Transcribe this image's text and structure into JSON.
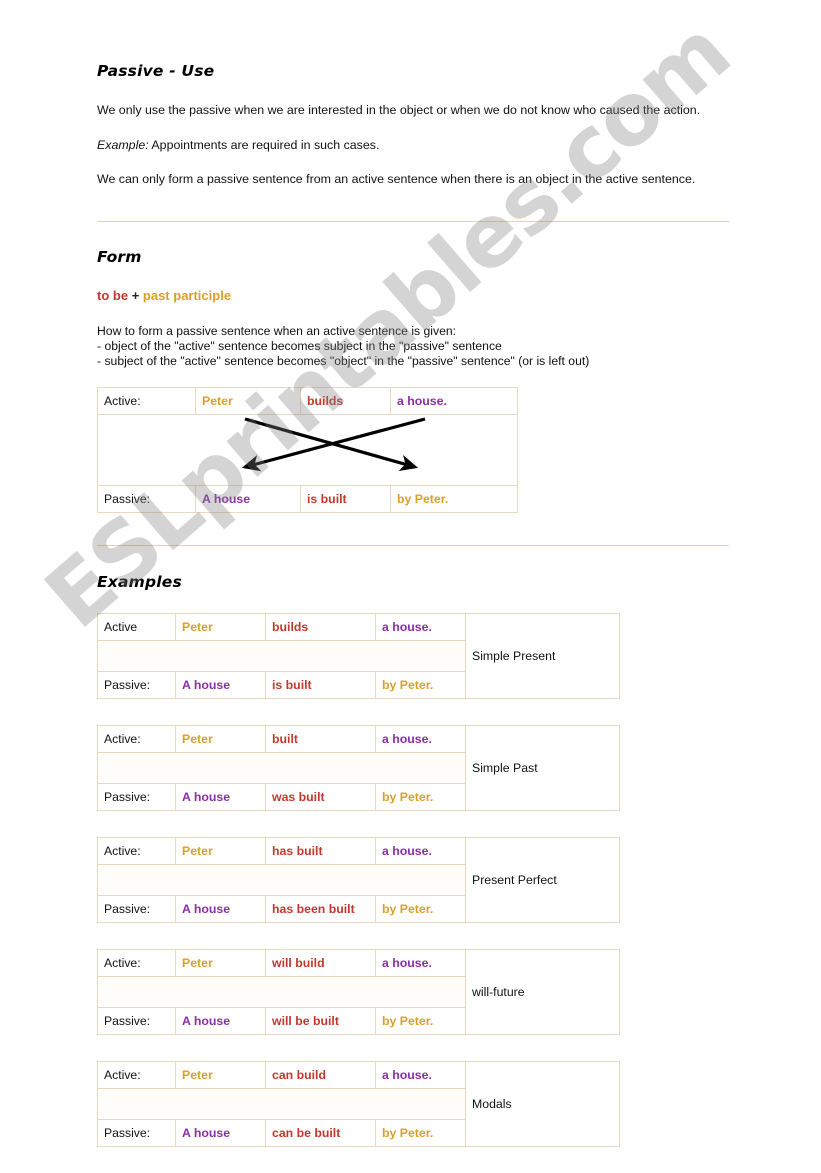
{
  "document": {
    "watermark": "ESLprintables.com"
  },
  "sections": {
    "use": {
      "title": "Passive - Use",
      "paragraph1": "We only use the passive when we are interested in the object or when we do not know who caused the action.",
      "example_label": "Example:",
      "example_text": "Appointments are required in such cases.",
      "paragraph2": "We can only form a passive sentence from an active sentence when there is an object in the active sentence."
    },
    "form": {
      "title": "Form",
      "formula": {
        "to_be": "to be",
        "plus": "+",
        "past_participle": "past participle"
      },
      "rules_intro": "How to form a passive sentence when an active sentence is given:",
      "rule1": "- object of the \"active\" sentence becomes subject in the \"passive\" sentence",
      "rule2": "- subject of the \"active\" sentence becomes \"object\" in the \"passive\" sentence\" (or is left out)",
      "table": {
        "active_label": "Active:",
        "active_subject": "Peter",
        "active_verb": "builds",
        "active_object": "a house.",
        "passive_label": "Passive:",
        "passive_subject": "A house",
        "passive_verb": "is built",
        "passive_agent": "by Peter."
      }
    },
    "examples": {
      "title": "Examples",
      "tables": [
        {
          "active_label": "Active",
          "active_subject": "Peter",
          "active_verb": "builds",
          "active_object": "a house.",
          "passive_label": "Passive:",
          "passive_subject": "A house",
          "passive_verb": "is built",
          "passive_agent": "by Peter.",
          "tense": "Simple Present"
        },
        {
          "active_label": "Active:",
          "active_subject": "Peter",
          "active_verb": "built",
          "active_object": "a house.",
          "passive_label": "Passive:",
          "passive_subject": "A house",
          "passive_verb": "was built",
          "passive_agent": "by Peter.",
          "tense": "Simple Past"
        },
        {
          "active_label": "Active:",
          "active_subject": "Peter",
          "active_verb": "has built",
          "active_object": "a house.",
          "passive_label": "Passive:",
          "passive_subject": "A house",
          "passive_verb": "has been built",
          "passive_agent": "by Peter.",
          "tense": "Present Perfect"
        },
        {
          "active_label": "Active:",
          "active_subject": "Peter",
          "active_verb": "will build",
          "active_object": "a house.",
          "passive_label": "Passive:",
          "passive_subject": "A house",
          "passive_verb": "will be built",
          "passive_agent": "by Peter.",
          "tense": "will-future"
        },
        {
          "active_label": "Active:",
          "active_subject": "Peter",
          "active_verb": "can build",
          "active_object": "a house.",
          "passive_label": "Passive:",
          "passive_subject": "A house",
          "passive_verb": "can be built",
          "passive_agent": "by Peter.",
          "tense": "Modals"
        }
      ]
    }
  },
  "colors": {
    "subject": "#d9a02b",
    "verb": "#c0392b",
    "object": "#8b2fa8",
    "divider": "#e3d2b4",
    "table_border": "#e8d8c0",
    "watermark": "#828282"
  }
}
